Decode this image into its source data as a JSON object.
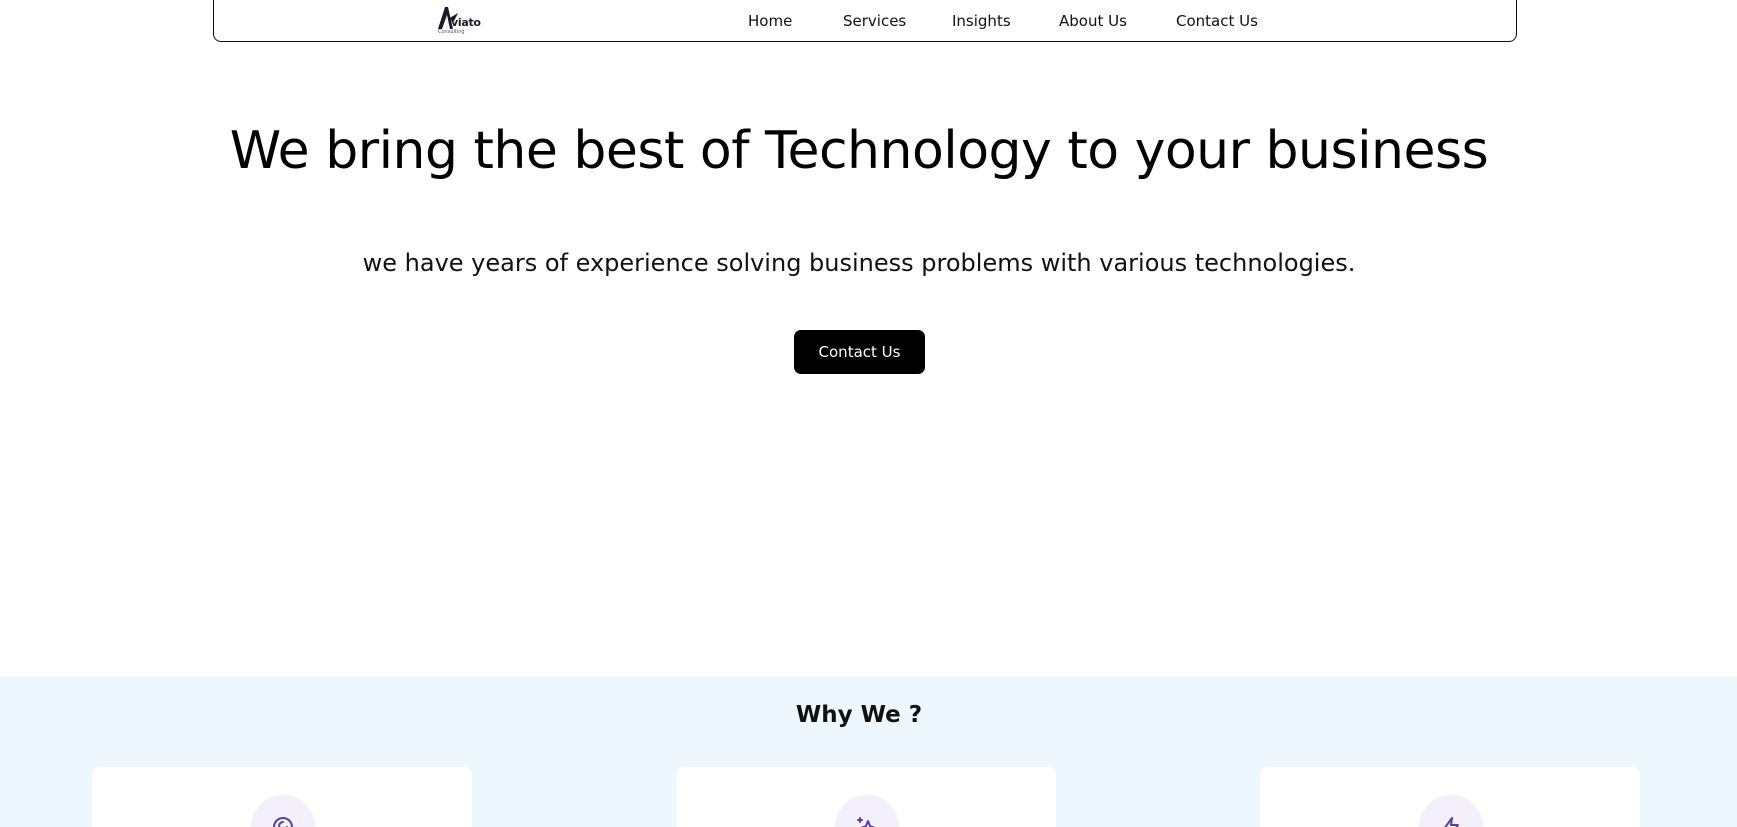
{
  "header": {
    "logo_text": "viato",
    "logo_subtext": "Consulting",
    "nav": [
      {
        "label": "Home"
      },
      {
        "label": "Services"
      },
      {
        "label": "Insights"
      },
      {
        "label": "About Us"
      },
      {
        "label": "Contact Us"
      }
    ]
  },
  "hero": {
    "title": "We bring the best of Technology to your business",
    "subtitle": "we have years of experience solving business problems with various technologies.",
    "cta_label": "Contact Us"
  },
  "why": {
    "title": "Why We ?",
    "cards": [
      {
        "icon": "target-icon"
      },
      {
        "icon": "sparkles-icon"
      },
      {
        "icon": "lightning-icon"
      }
    ]
  },
  "colors": {
    "accent": "#5b3fa6",
    "section_bg": "#eef6fe",
    "button_bg": "#000000"
  }
}
